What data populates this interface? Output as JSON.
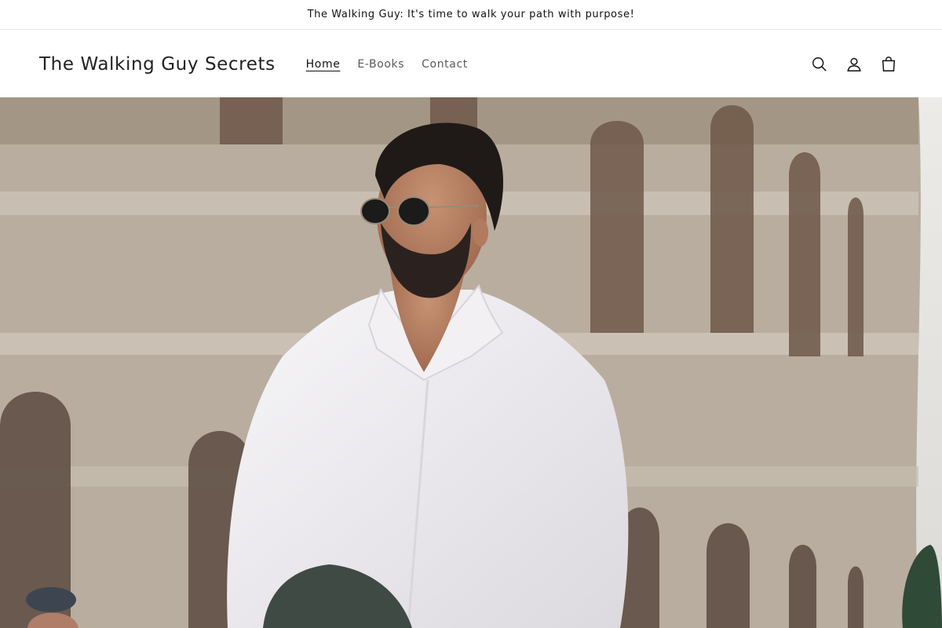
{
  "announcement": {
    "text": "The Walking Guy: It's time to walk your path with purpose!"
  },
  "header": {
    "logo": "The Walking Guy Secrets",
    "nav": [
      {
        "label": "Home",
        "active": true
      },
      {
        "label": "E-Books",
        "active": false
      },
      {
        "label": "Contact",
        "active": false
      }
    ],
    "icons": [
      "search-icon",
      "account-icon",
      "cart-icon"
    ]
  },
  "hero": {
    "image": "man-in-white-shirt-with-sunglasses-in-front-of-colosseum"
  },
  "colors": {
    "text": "#121212",
    "background": "#ffffff",
    "border": "#e6e6e6"
  }
}
